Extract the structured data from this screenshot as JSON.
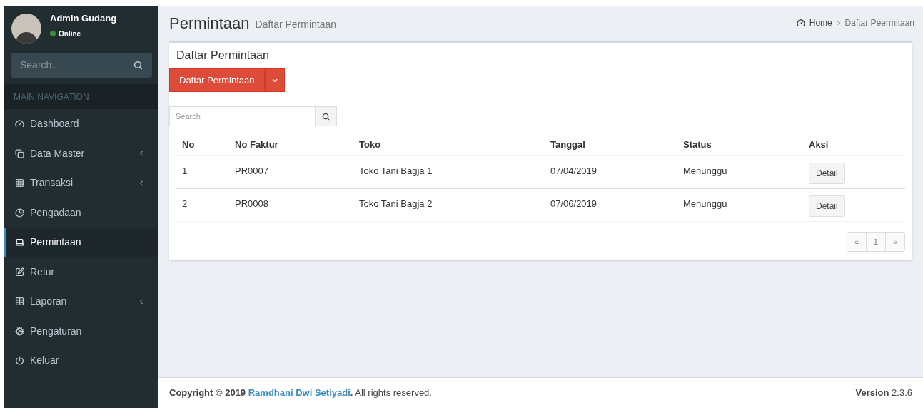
{
  "sidebar": {
    "user": {
      "name": "Admin Gudang",
      "status": "Online",
      "online": true
    },
    "search": {
      "placeholder": "Search..."
    },
    "section_header": "MAIN NAVIGATION",
    "items": [
      {
        "label": "Dashboard",
        "submenu": false,
        "selected": false
      },
      {
        "label": "Data Master",
        "submenu": true,
        "selected": false
      },
      {
        "label": "Transaksi",
        "submenu": true,
        "selected": false
      },
      {
        "label": "Pengadaan",
        "submenu": false,
        "selected": false
      },
      {
        "label": "Permintaan",
        "submenu": false,
        "selected": true
      },
      {
        "label": "Retur",
        "submenu": false,
        "selected": false
      },
      {
        "label": "Laporan",
        "submenu": true,
        "selected": false
      },
      {
        "label": "Pengaturan",
        "submenu": false,
        "selected": false
      },
      {
        "label": "Keluar",
        "submenu": false,
        "selected": false
      }
    ]
  },
  "header": {
    "title": "Permintaan",
    "subtitle": "Daftar Permintaan",
    "breadcrumb": [
      "Home",
      "Daftar Peermitaan"
    ],
    "breadcrumb_separator": ">"
  },
  "box": {
    "title": "Daftar Permintaan",
    "dropdown_button": "Daftar Permintaan",
    "search": {
      "placeholder": "Search"
    },
    "table": {
      "columns": [
        "No",
        "No Faktur",
        "Toko",
        "Tanggal",
        "Status",
        "Aksi"
      ],
      "rows": [
        {
          "no": "1",
          "faktur": "PR0007",
          "toko": "Toko Tani Bagja 1",
          "tanggal": "07/04/2019",
          "status": "Menunggu",
          "action": "Detail"
        },
        {
          "no": "2",
          "faktur": "PR0008",
          "toko": "Toko Tani Bagja 2",
          "tanggal": "07/06/2019",
          "status": "Menunggu",
          "action": "Detail"
        }
      ]
    },
    "pagination": [
      {
        "label": "«",
        "selected": false
      },
      {
        "label": "1",
        "selected": false
      },
      {
        "label": "»",
        "selected": false
      }
    ]
  },
  "footer": {
    "copyright": "Copyright © 2019",
    "author": "Ramdhani Dwi Setiyadi",
    "rest": "**.** All rights reserved.",
    "version_label": "Version",
    "version": "2.3.6"
  }
}
